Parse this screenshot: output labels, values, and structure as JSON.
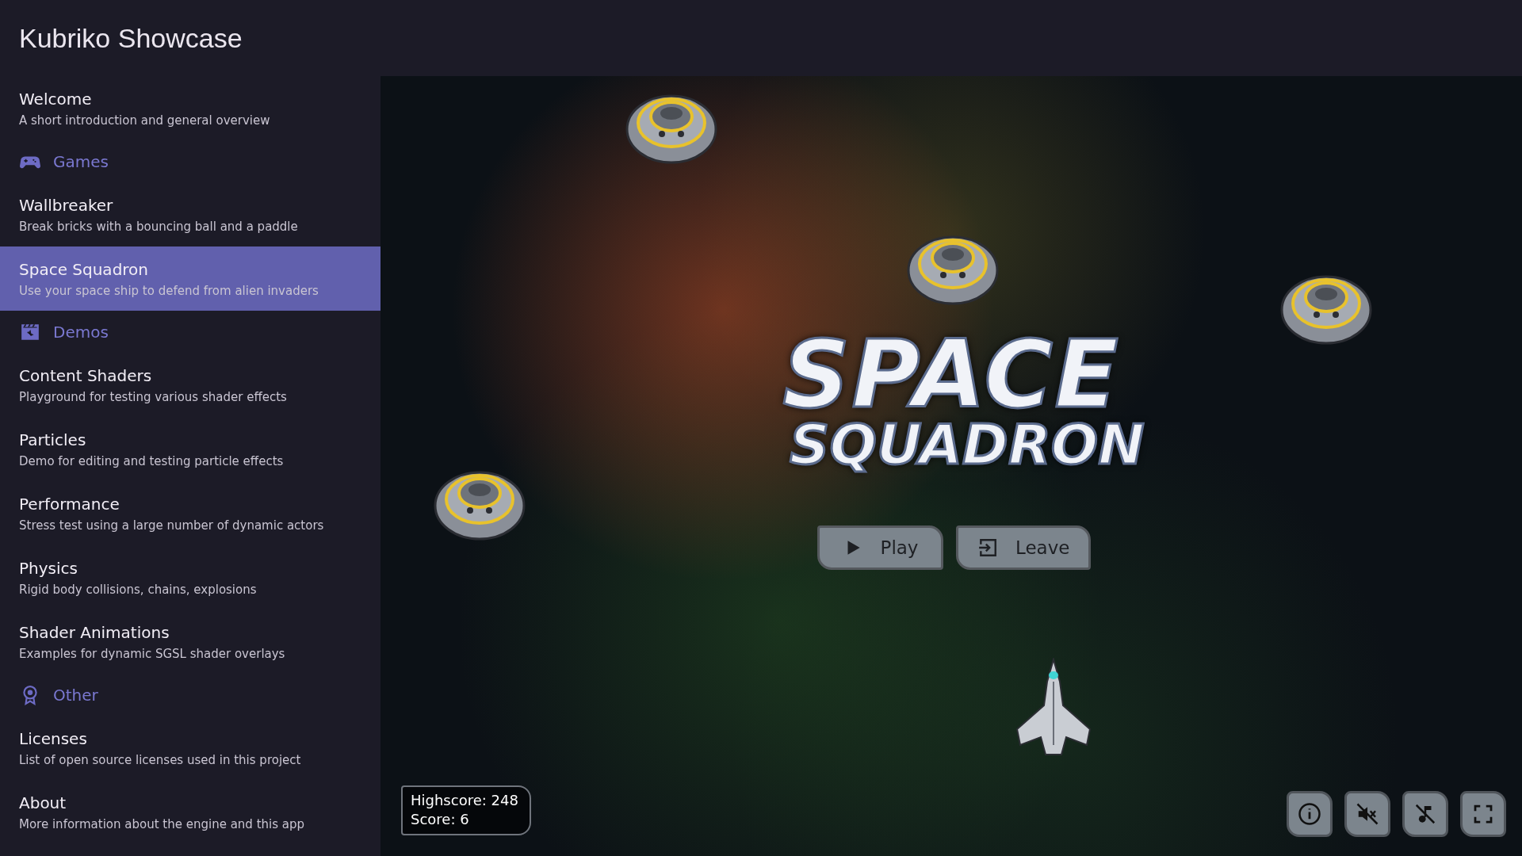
{
  "app": {
    "title": "Kubriko Showcase"
  },
  "sidebar": {
    "items": [
      {
        "kind": "page",
        "title": "Welcome",
        "description": "A short introduction and general overview",
        "selected": false
      },
      {
        "kind": "section",
        "label": "Games"
      },
      {
        "kind": "page",
        "title": "Wallbreaker",
        "description": "Break bricks with a bouncing ball and a paddle",
        "selected": false
      },
      {
        "kind": "page",
        "title": "Space Squadron",
        "description": "Use your space ship to defend from alien invaders",
        "selected": true
      },
      {
        "kind": "section",
        "label": "Demos"
      },
      {
        "kind": "page",
        "title": "Content Shaders",
        "description": "Playground for testing various shader effects",
        "selected": false
      },
      {
        "kind": "page",
        "title": "Particles",
        "description": "Demo for editing and testing particle effects",
        "selected": false
      },
      {
        "kind": "page",
        "title": "Performance",
        "description": "Stress test using a large number of dynamic actors",
        "selected": false
      },
      {
        "kind": "page",
        "title": "Physics",
        "description": "Rigid body collisions, chains, explosions",
        "selected": false
      },
      {
        "kind": "page",
        "title": "Shader Animations",
        "description": "Examples for dynamic SGSL shader overlays",
        "selected": false
      },
      {
        "kind": "section",
        "label": "Other"
      },
      {
        "kind": "page",
        "title": "Licenses",
        "description": "List of open source licenses used in this project",
        "selected": false
      },
      {
        "kind": "page",
        "title": "About",
        "description": "More information about the engine and this app",
        "selected": false
      }
    ]
  },
  "game": {
    "logo_lines": [
      "SPACE",
      "SQUADRON"
    ],
    "buttons": [
      {
        "label": "Play"
      },
      {
        "label": "Leave"
      }
    ],
    "hud": {
      "highscore": "Highscore: 248",
      "score": "Score: 6"
    }
  }
}
